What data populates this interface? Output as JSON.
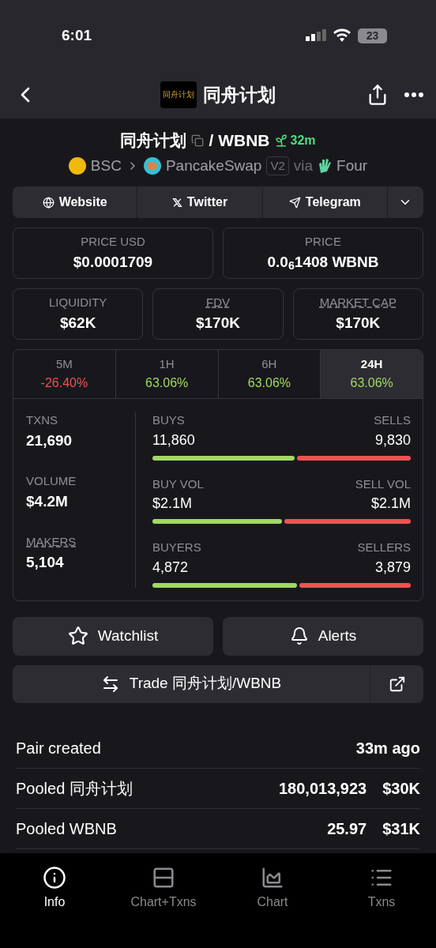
{
  "status_bar": {
    "time": "6:01",
    "battery": "23"
  },
  "header": {
    "logo_text": "同舟计划",
    "title": "同舟计划"
  },
  "pair": {
    "base": "同舟计划",
    "quote": "/ WBNB",
    "age": "32m",
    "chain": "BSC",
    "dex": "PancakeSwap",
    "version": "V2",
    "via": "via",
    "launchpad": "Four"
  },
  "links": [
    {
      "kind": "globe",
      "label": "Website"
    },
    {
      "kind": "x",
      "label": "Twitter"
    },
    {
      "kind": "telegram",
      "label": "Telegram"
    }
  ],
  "price_cards": [
    {
      "label": "PRICE USD",
      "value": "$0.0001709",
      "dotted": false
    },
    {
      "label": "PRICE",
      "value": "0.0$_{6}$1408 WBNB",
      "dotted": false
    }
  ],
  "metric_cards": [
    {
      "label": "LIQUIDITY",
      "value": "$62K",
      "dotted": false
    },
    {
      "label": "FDV",
      "value": "$170K",
      "dotted": true
    },
    {
      "label": "MARKET CAP",
      "value": "$170K",
      "dotted": true
    }
  ],
  "timeframes": [
    {
      "label": "5M",
      "change": "-26.40%",
      "kind": "down",
      "selected": false
    },
    {
      "label": "1H",
      "change": "63.06%",
      "kind": "up",
      "selected": false
    },
    {
      "label": "6H",
      "change": "63.06%",
      "kind": "up",
      "selected": false
    },
    {
      "label": "24H",
      "change": "63.06%",
      "kind": "up",
      "selected": true
    }
  ],
  "stats": [
    {
      "label": "TXNS",
      "value": "21,690",
      "dotted": false,
      "left_label": "BUYS",
      "left_value": "11,860",
      "right_label": "SELLS",
      "right_value": "9,830",
      "level": 0.55
    },
    {
      "label": "VOLUME",
      "value": "$4.2M",
      "dotted": false,
      "left_label": "BUY VOL",
      "left_value": "$2.1M",
      "right_label": "SELL VOL",
      "right_value": "$2.1M",
      "level": 0.5
    },
    {
      "label": "MAKERS",
      "value": "5,104",
      "dotted": true,
      "left_label": "BUYERS",
      "left_value": "4,872",
      "right_label": "SELLERS",
      "right_value": "3,879",
      "level": 0.56
    }
  ],
  "actions": [
    {
      "kind": "star",
      "label": "Watchlist"
    },
    {
      "kind": "bell",
      "label": "Alerts"
    }
  ],
  "trade_button": "Trade 同舟计划/WBNB",
  "info_rows": [
    {
      "label": "Pair created",
      "values": [
        "33m ago"
      ]
    },
    {
      "label": "Pooled 同舟计划",
      "values": [
        "180,013,923",
        "$30K"
      ]
    },
    {
      "label": "Pooled WBNB",
      "values": [
        "25.97",
        "$31K"
      ]
    }
  ],
  "bottom_nav": [
    {
      "kind": "info",
      "label": "Info",
      "selected": true
    },
    {
      "kind": "split",
      "label": "Chart+Txns",
      "selected": false
    },
    {
      "kind": "chart",
      "label": "Chart",
      "selected": false
    },
    {
      "kind": "list",
      "label": "Txns",
      "selected": false
    }
  ]
}
